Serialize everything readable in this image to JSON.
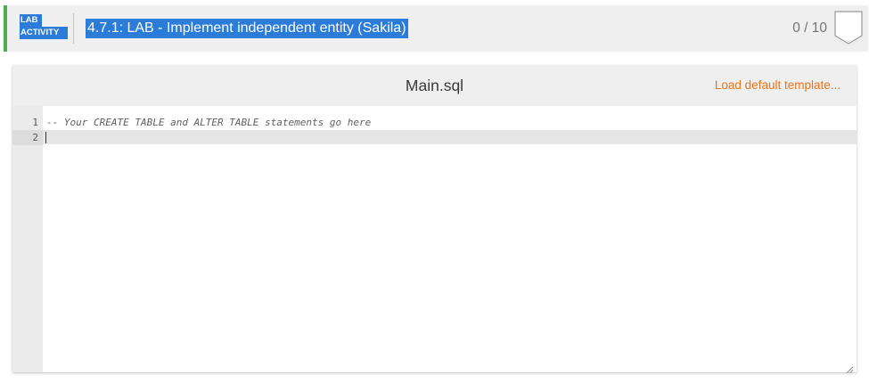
{
  "lab": {
    "tag_line1": "LAB",
    "tag_line2": "ACTIVITY",
    "title": "4.7.1: LAB - Implement independent entity (Sakila)",
    "score": "0 / 10",
    "accent_color": "#4caf50",
    "highlight_color": "#2b7bd9"
  },
  "editor": {
    "filename": "Main.sql",
    "load_template_label": "Load default template...",
    "load_template_color": "#e8751a",
    "line_numbers": [
      "1",
      "2"
    ],
    "lines": [
      "-- Your CREATE TABLE and ALTER TABLE statements go here",
      ""
    ]
  },
  "icons": {
    "score_badge": "score-badge-icon",
    "resize_grip": "resize-grip-icon"
  }
}
